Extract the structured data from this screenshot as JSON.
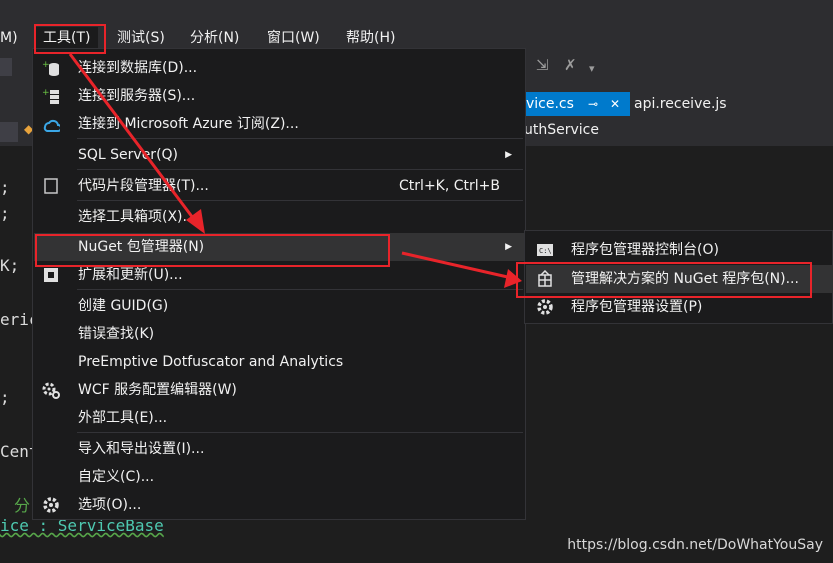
{
  "menubar": {
    "items": [
      "M)",
      "工具(T)",
      "测试(S)",
      "分析(N)",
      "窗口(W)",
      "帮助(H)"
    ]
  },
  "tabs": {
    "active": "vice.cs",
    "pin": "⊸",
    "close": "✕",
    "other": "api.receive.js"
  },
  "navbar": {
    "text": "uthService"
  },
  "editor": {
    "lines": [
      ";",
      ";",
      "K;",
      "eric",
      ";",
      "Cent",
      "分",
      "ice : ServiceBase"
    ]
  },
  "tools_menu": {
    "items": [
      {
        "label": "连接到数据库(D)...",
        "icon": "database-connect-icon"
      },
      {
        "label": "连接到服务器(S)...",
        "icon": "server-connect-icon"
      },
      {
        "label": "连接到 Microsoft Azure 订阅(Z)...",
        "icon": "azure-cloud-icon"
      },
      {
        "label": "SQL Server(Q)",
        "submenu": true
      },
      {
        "label": "代码片段管理器(T)...",
        "shortcut": "Ctrl+K, Ctrl+B",
        "icon": "snippet-icon"
      },
      {
        "label": "选择工具箱项(X)..."
      },
      {
        "label": "NuGet 包管理器(N)",
        "submenu": true
      },
      {
        "label": "扩展和更新(U)...",
        "icon": "extensions-icon"
      },
      {
        "label": "创建 GUID(G)"
      },
      {
        "label": "错误查找(K)"
      },
      {
        "label": "PreEmptive Dotfuscator and Analytics"
      },
      {
        "label": "WCF 服务配置编辑器(W)",
        "icon": "wcf-gear-icon"
      },
      {
        "label": "外部工具(E)..."
      },
      {
        "label": "导入和导出设置(I)..."
      },
      {
        "label": "自定义(C)..."
      },
      {
        "label": "选项(O)...",
        "icon": "gear-icon"
      }
    ]
  },
  "nuget_submenu": {
    "items": [
      {
        "label": "程序包管理器控制台(O)",
        "icon": "console-icon"
      },
      {
        "label": "管理解决方案的 NuGet 程序包(N)...",
        "icon": "nuget-package-icon"
      },
      {
        "label": "程序包管理器设置(P)",
        "icon": "gear-icon"
      }
    ]
  },
  "watermark": "https://blog.csdn.net/DoWhatYouSay",
  "colors": {
    "accent": "#007acc",
    "annotation": "#e8242a",
    "menu_bg": "#1b1b1c",
    "chrome": "#2d2d30"
  }
}
